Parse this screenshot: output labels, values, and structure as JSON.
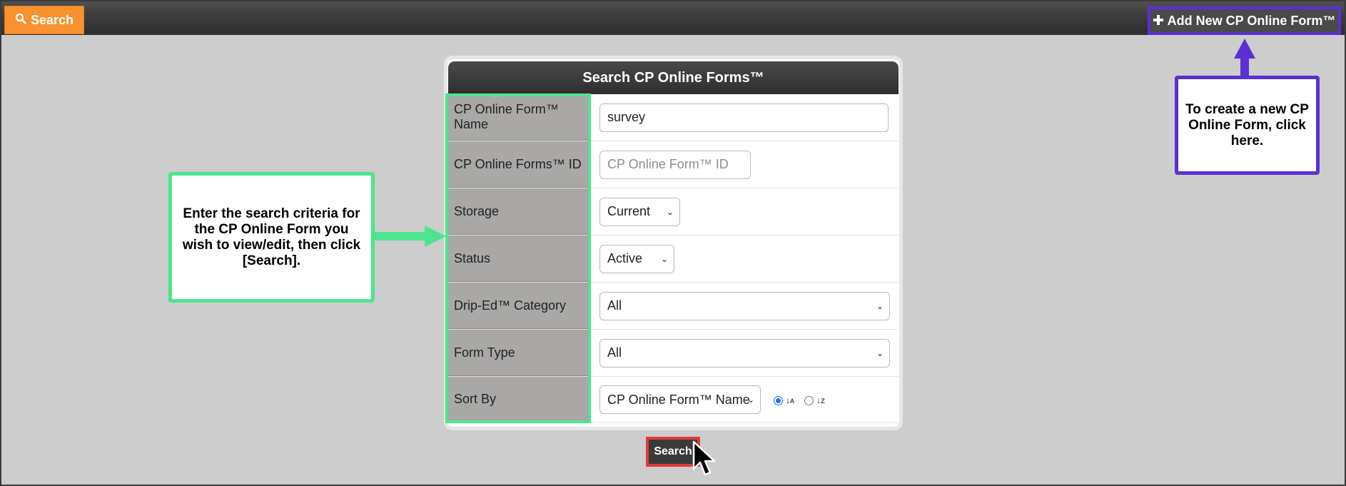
{
  "topbar": {
    "search_tab_label": "Search",
    "add_button_label": "Add New CP Online Form™"
  },
  "panel": {
    "title": "Search CP Online Forms™",
    "rows": [
      {
        "label": "CP Online Form™ Name",
        "value": "survey"
      },
      {
        "label": "CP Online Forms™ ID",
        "placeholder": "CP Online Form™ ID"
      },
      {
        "label": "Storage",
        "selected": "Current"
      },
      {
        "label": "Status",
        "selected": "Active"
      },
      {
        "label": "Drip-Ed™ Category",
        "selected": "All"
      },
      {
        "label": "Form Type",
        "selected": "All"
      },
      {
        "label": "Sort By",
        "selected": "CP Online Form™ Name"
      }
    ]
  },
  "search_button_label": "Search",
  "callouts": {
    "left": "Enter the search criteria for the CP Online Form you wish to view/edit, then click [Search].",
    "right": "To create a new CP Online Form, click here."
  },
  "colors": {
    "accent_orange": "#f7922f",
    "callout_green": "#4ee48f",
    "callout_purple": "#5a30d6",
    "highlight_red": "#e23a3a"
  }
}
